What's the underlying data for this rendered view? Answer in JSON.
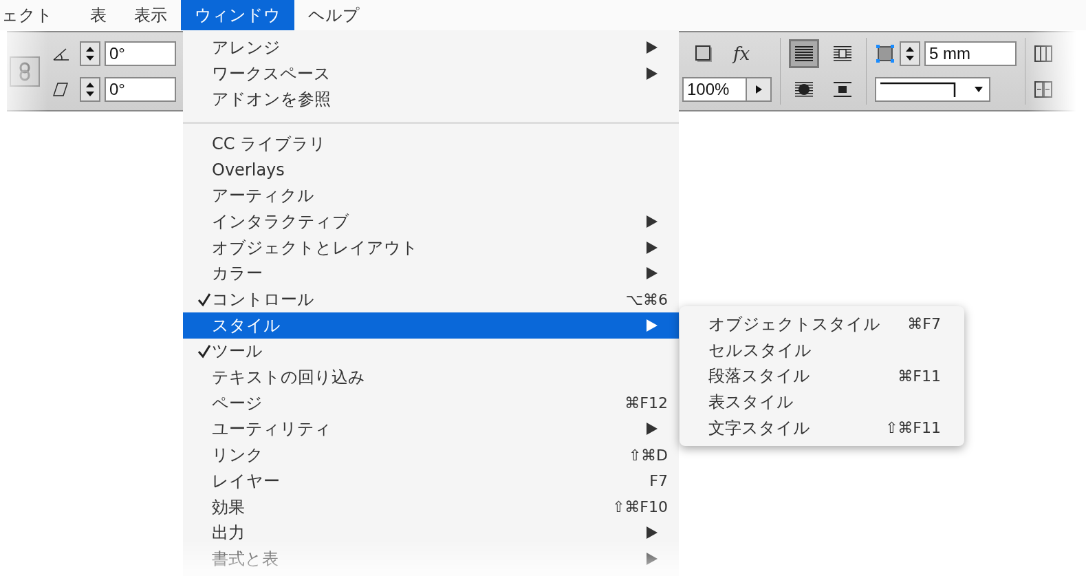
{
  "menubar": [
    {
      "label": "ェクト",
      "selected": false
    },
    {
      "label": "表",
      "selected": false
    },
    {
      "label": "表示",
      "selected": false
    },
    {
      "label": "ウィンドウ",
      "selected": true
    },
    {
      "label": "ヘルプ",
      "selected": false
    }
  ],
  "toolbar": {
    "rotate_angle": "0°",
    "shear_angle": "0°",
    "opacity": "100%",
    "effects": "fx",
    "offset": "5 mm",
    "wrap_buttons": [
      {
        "selected": true
      },
      {
        "selected": false
      },
      {
        "selected": false
      },
      {
        "selected": false
      }
    ]
  },
  "menu": {
    "items": [
      {
        "kind": "item",
        "label": "アレンジ",
        "checked": false,
        "submenu": true,
        "selected": false
      },
      {
        "kind": "item",
        "label": "ワークスペース",
        "checked": false,
        "submenu": true,
        "selected": false
      },
      {
        "kind": "item",
        "label": "アドオンを参照",
        "checked": false,
        "submenu": false,
        "selected": false
      },
      {
        "kind": "separator"
      },
      {
        "kind": "item",
        "label": "CC ライブラリ",
        "checked": false,
        "submenu": false,
        "selected": false
      },
      {
        "kind": "item",
        "label": "Overlays",
        "checked": false,
        "submenu": false,
        "selected": false
      },
      {
        "kind": "item",
        "label": "アーティクル",
        "checked": false,
        "submenu": false,
        "selected": false
      },
      {
        "kind": "item",
        "label": "インタラクティブ",
        "checked": false,
        "submenu": true,
        "selected": false
      },
      {
        "kind": "item",
        "label": "オブジェクトとレイアウト",
        "checked": false,
        "submenu": true,
        "selected": false
      },
      {
        "kind": "item",
        "label": "カラー",
        "checked": false,
        "submenu": true,
        "selected": false
      },
      {
        "kind": "item",
        "label": "コントロール",
        "checked": true,
        "submenu": false,
        "shortcut": "⌥⌘6",
        "selected": false
      },
      {
        "kind": "item",
        "label": "スタイル",
        "checked": false,
        "submenu": true,
        "selected": true
      },
      {
        "kind": "item",
        "label": "ツール",
        "checked": true,
        "submenu": false,
        "selected": false
      },
      {
        "kind": "item",
        "label": "テキストの回り込み",
        "checked": false,
        "submenu": false,
        "selected": false
      },
      {
        "kind": "item",
        "label": "ページ",
        "checked": false,
        "submenu": false,
        "shortcut": "⌘F12",
        "selected": false
      },
      {
        "kind": "item",
        "label": "ユーティリティ",
        "checked": false,
        "submenu": true,
        "selected": false
      },
      {
        "kind": "item",
        "label": "リンク",
        "checked": false,
        "submenu": false,
        "shortcut": "⇧⌘D",
        "selected": false
      },
      {
        "kind": "item",
        "label": "レイヤー",
        "checked": false,
        "submenu": false,
        "shortcut": "F7",
        "selected": false
      },
      {
        "kind": "item",
        "label": "効果",
        "checked": false,
        "submenu": false,
        "shortcut": "⇧⌘F10",
        "selected": false
      },
      {
        "kind": "item",
        "label": "出力",
        "checked": false,
        "submenu": true,
        "selected": false
      },
      {
        "kind": "item",
        "label": "書式と表",
        "checked": false,
        "submenu": true,
        "selected": false
      }
    ]
  },
  "submenu": {
    "items": [
      {
        "label": "オブジェクトスタイル",
        "shortcut": "⌘F7"
      },
      {
        "label": "セルスタイル"
      },
      {
        "label": "段落スタイル",
        "shortcut": "⌘F11"
      },
      {
        "label": "表スタイル"
      },
      {
        "label": "文字スタイル",
        "shortcut": "⇧⌘F11"
      }
    ]
  }
}
